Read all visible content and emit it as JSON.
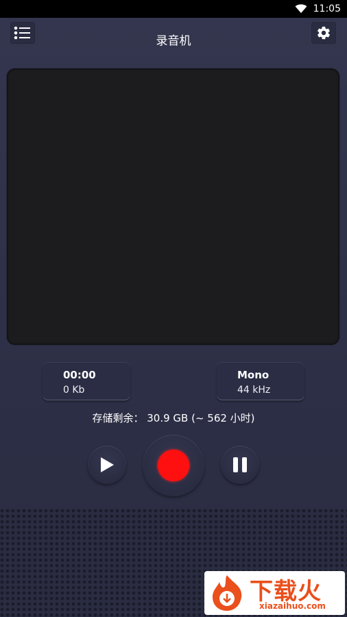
{
  "status_bar": {
    "time": "11:05"
  },
  "header": {
    "title": "录音机",
    "menu_icon": "list-icon",
    "settings_icon": "gear-icon"
  },
  "recording_info": {
    "duration": "00:00",
    "size": "0 Kb",
    "channel": "Mono",
    "sample_rate": "44 kHz"
  },
  "storage": {
    "text": "存储剩余： 30.9 GB (~ 562 小时)"
  },
  "controls": {
    "play_icon": "play-icon",
    "record_icon": "record-icon",
    "pause_icon": "pause-icon"
  },
  "watermark": {
    "cn": "下载火",
    "en": "xiazaihuo.com"
  },
  "colors": {
    "background": "#2e3047",
    "screen": "#1c1c1f",
    "record_red": "#ff1010",
    "watermark_orange": "#ea4f1c"
  }
}
